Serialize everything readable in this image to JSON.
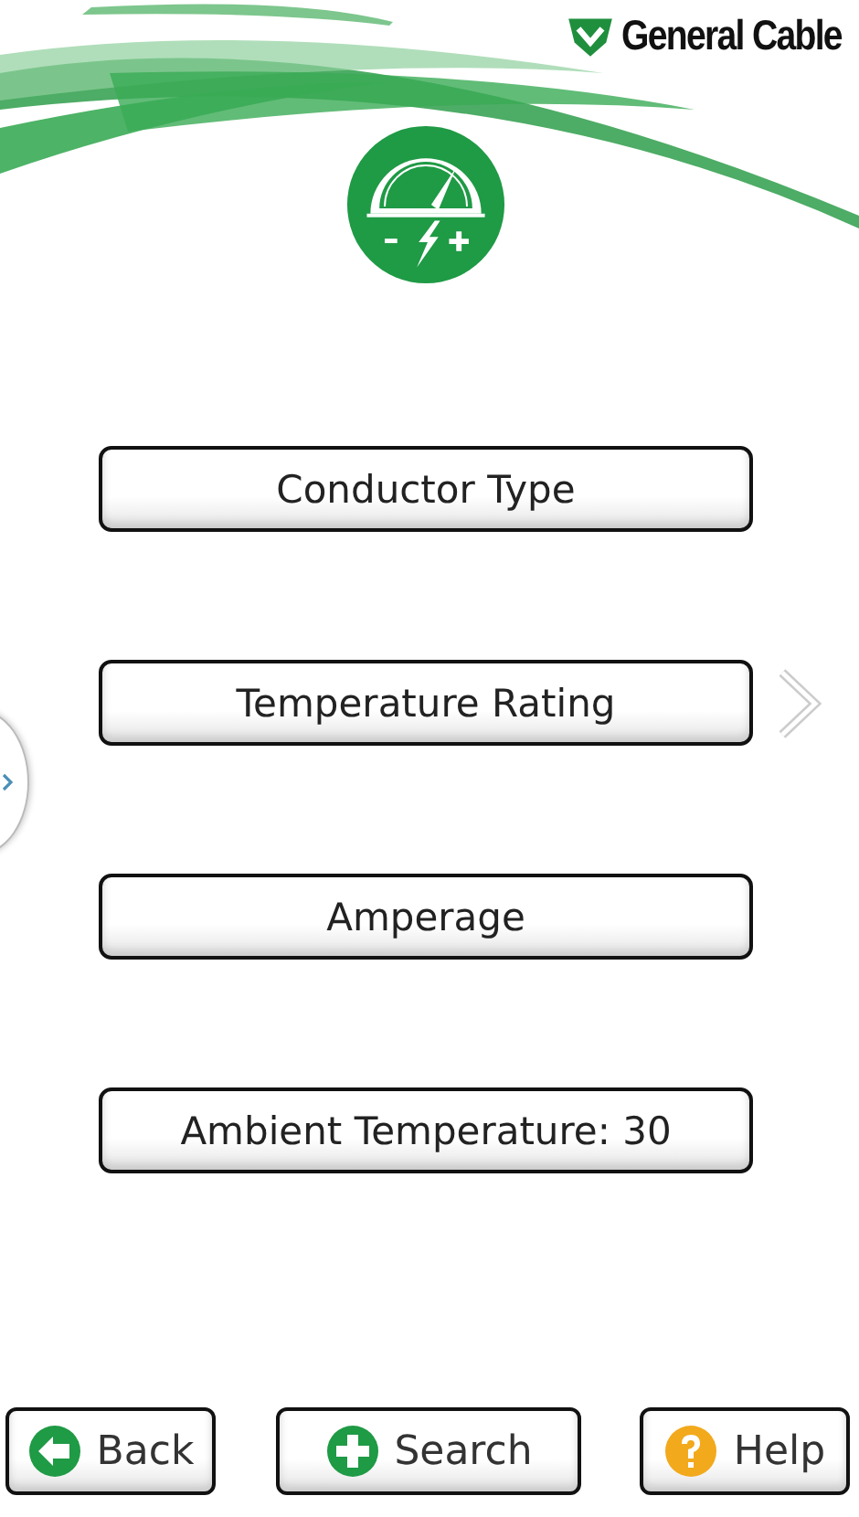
{
  "brand": {
    "name": "General Cable"
  },
  "menu": [
    {
      "label": "Conductor Type"
    },
    {
      "label": "Temperature Rating"
    },
    {
      "label": "Amperage"
    },
    {
      "label": "Ambient Temperature: 30"
    }
  ],
  "footer": [
    {
      "kind": "back",
      "label": "Back"
    },
    {
      "kind": "search",
      "label": "Search"
    },
    {
      "kind": "help",
      "label": "Help"
    }
  ]
}
